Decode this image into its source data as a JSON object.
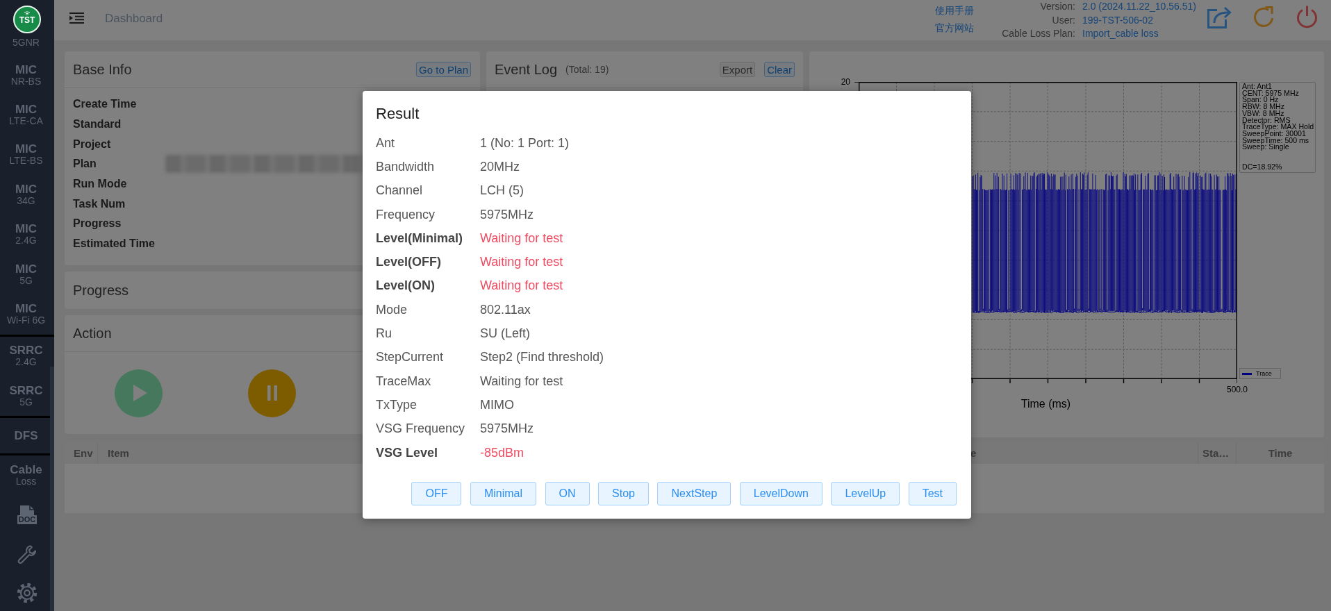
{
  "sidebar": {
    "logo": "TST",
    "sections": [
      {
        "items": [
          {
            "subtitle": "5GNR"
          },
          {
            "title": "MIC",
            "subtitle": "NR-BS"
          },
          {
            "title": "MIC",
            "subtitle": "LTE-CA"
          },
          {
            "title": "MIC",
            "subtitle": "LTE-BS"
          },
          {
            "title": "MIC",
            "subtitle": "34G"
          },
          {
            "title": "MIC",
            "subtitle": "2.4G"
          },
          {
            "title": "MIC",
            "subtitle": "5G"
          },
          {
            "title": "MIC",
            "subtitle": "Wi-Fi 6G"
          }
        ]
      },
      {
        "items": [
          {
            "title": "SRRC",
            "subtitle": "2.4G"
          },
          {
            "title": "SRRC",
            "subtitle": "5G"
          }
        ]
      },
      {
        "items": [
          {
            "title": "DFS"
          }
        ]
      },
      {
        "items": [
          {
            "title": "Cable",
            "subtitle": "Loss"
          }
        ]
      }
    ],
    "doc_label": "DOC"
  },
  "header": {
    "breadcrumb": "Dashboard",
    "links": [
      "使用手册",
      "官方网站"
    ],
    "info": [
      {
        "label": "Version:",
        "value": "2.0 (2024.11.22_10.56.51)"
      },
      {
        "label": "User:",
        "value": "199-TST-506-02"
      },
      {
        "label": "Cable Loss Plan:",
        "value": "Import_cable loss"
      }
    ]
  },
  "base_info": {
    "title": "Base Info",
    "button": "Go to Plan",
    "fields": [
      {
        "label": "Create Time",
        "blurred": false
      },
      {
        "label": "Standard",
        "blurred": false
      },
      {
        "label": "Project",
        "blurred": false
      },
      {
        "label": "Plan",
        "blurred": true
      },
      {
        "label": "Run Mode",
        "blurred": false
      },
      {
        "label": "Task Num",
        "blurred": false
      },
      {
        "label": "Progress",
        "blurred": false
      },
      {
        "label": "Estimated Time",
        "blurred": false
      }
    ]
  },
  "progress_panel": {
    "title": "Progress"
  },
  "action_panel": {
    "title": "Action"
  },
  "event_log": {
    "title": "Event Log",
    "total": "(Total: 19)",
    "buttons": [
      {
        "label": "Export",
        "kind": "default"
      },
      {
        "label": "Clear",
        "kind": "primary"
      }
    ]
  },
  "chart_panel": {
    "y_top_label": "20",
    "x_end_label": "500.0",
    "xlabel": "Time (ms)",
    "settings": [
      "Ant: Ant1",
      "CENT: 5975 MHz",
      "Span: 0 Hz",
      "RBW: 8 MHz",
      "VBW: 8 MHz",
      "Detector: RMS",
      "TraceType: MAX Hold",
      "SweepPoint: 30001",
      "SweepTime: 500 ms",
      "Sweep: Single"
    ],
    "result": "DC=18.92%",
    "legend": "Trace"
  },
  "table": {
    "columns": [
      "Env",
      "Item",
      "e",
      "Sta…",
      "Time"
    ]
  },
  "result_dialog": {
    "title": "Result",
    "rows": [
      {
        "label": "Ant",
        "value": "1 (No: 1 Port: 1)",
        "highlighted": false
      },
      {
        "label": "Bandwidth",
        "value": "20MHz",
        "highlighted": false
      },
      {
        "label": "Channel",
        "value": "LCH (5)",
        "highlighted": false
      },
      {
        "label": "Frequency",
        "value": "5975MHz",
        "highlighted": false
      },
      {
        "label": "Level(Minimal)",
        "value": "Waiting for test",
        "highlighted": true
      },
      {
        "label": "Level(OFF)",
        "value": "Waiting for test",
        "highlighted": true
      },
      {
        "label": "Level(ON)",
        "value": "Waiting for test",
        "highlighted": true
      },
      {
        "label": "Mode",
        "value": "802.11ax",
        "highlighted": false
      },
      {
        "label": "Ru",
        "value": "SU (Left)",
        "highlighted": false
      },
      {
        "label": "StepCurrent",
        "value": "Step2 (Find threshold)",
        "highlighted": false
      },
      {
        "label": "TraceMax",
        "value": "Waiting for test",
        "highlighted": false
      },
      {
        "label": "TxType",
        "value": "MIMO",
        "highlighted": false
      },
      {
        "label": "VSG Frequency",
        "value": "5975MHz",
        "highlighted": false
      },
      {
        "label": "VSG Level",
        "value": "-85dBm",
        "highlighted": true
      }
    ],
    "buttons": [
      "OFF",
      "Minimal",
      "ON",
      "Stop",
      "NextStep",
      "LevelDown",
      "LevelUp",
      "Test"
    ]
  }
}
